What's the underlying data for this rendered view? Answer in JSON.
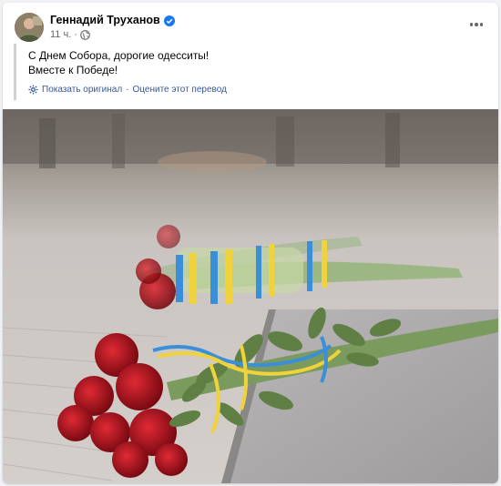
{
  "post": {
    "author": "Геннадий Труханов",
    "time": "11 ч.",
    "separator": "·",
    "text_line1": "С Днем Собора, дорогие одесситы!",
    "text_line2": "Вместе к Победе!",
    "show_original": "Показать оригинал",
    "dot_sep": "·",
    "rate_translation": "Оцените этот перевод"
  },
  "icons": {
    "verified": "verified-badge-icon",
    "privacy": "globe-icon",
    "more": "more-options-icon",
    "translate": "gear-icon"
  },
  "colors": {
    "link": "#385898",
    "meta": "#65676b",
    "verified": "#1877f2",
    "blue_ribbon": "#3a8fd8",
    "yellow_ribbon": "#f0d23c",
    "rose_red": "#b01020"
  }
}
